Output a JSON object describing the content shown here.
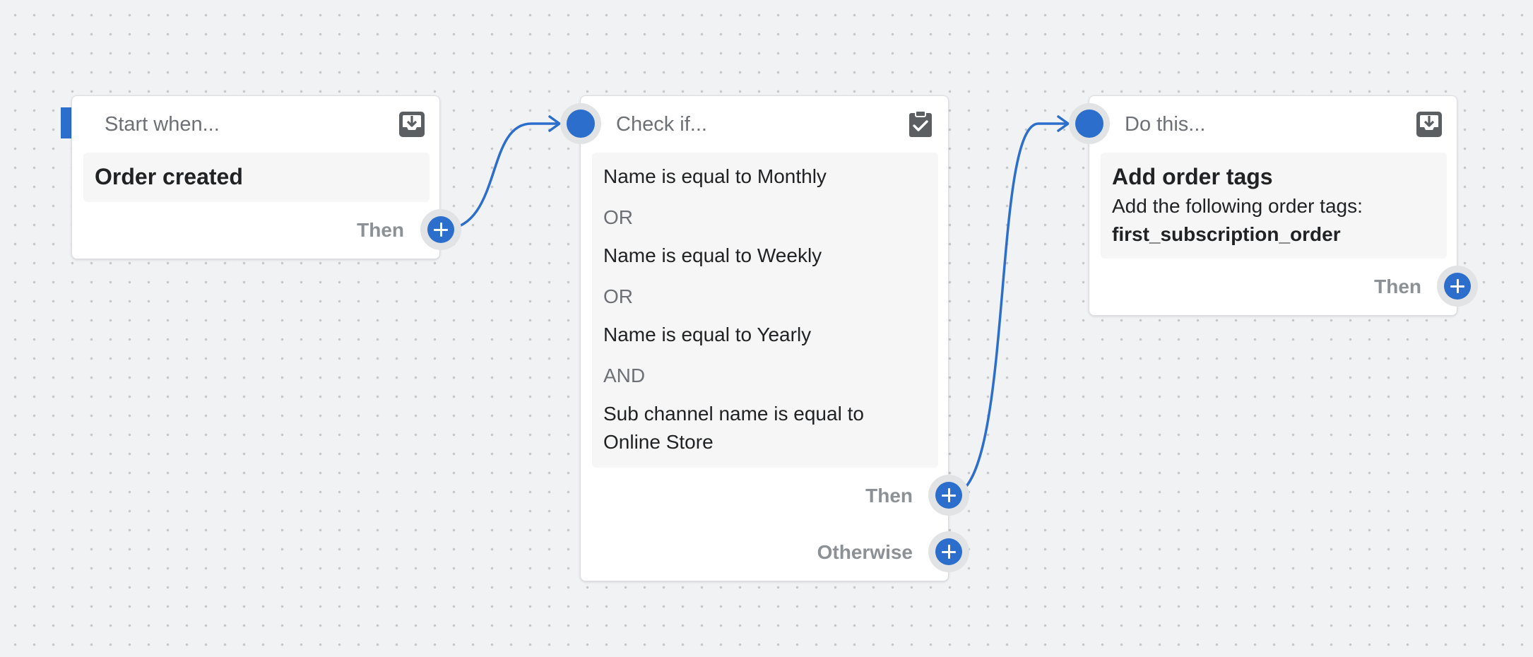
{
  "trigger_node": {
    "header": "Start when...",
    "header_icon": "download-tray-icon",
    "content_title": "Order created",
    "then_label": "Then"
  },
  "condition_node": {
    "header": "Check if...",
    "header_icon": "clipboard-check-icon",
    "conditions": [
      {
        "text": "Name is equal to Monthly"
      },
      {
        "operator": "OR"
      },
      {
        "text": "Name is equal to Weekly"
      },
      {
        "operator": "OR"
      },
      {
        "text": "Name is equal to Yearly"
      },
      {
        "operator": "AND"
      },
      {
        "text_line1": "Sub channel name is equal to",
        "text_line2": "Online Store"
      }
    ],
    "then_label": "Then",
    "otherwise_label": "Otherwise"
  },
  "action_node": {
    "header": "Do this...",
    "header_icon": "download-tray-icon",
    "content_title": "Add order tags",
    "description": "Add the following order tags:",
    "tag_value": "first_subscription_order",
    "then_label": "Then"
  },
  "colors": {
    "accent": "#2c6ecb",
    "canvas_bg": "#f1f2f4",
    "port_ring": "#e2e3e5",
    "muted_text": "#8c9196"
  }
}
